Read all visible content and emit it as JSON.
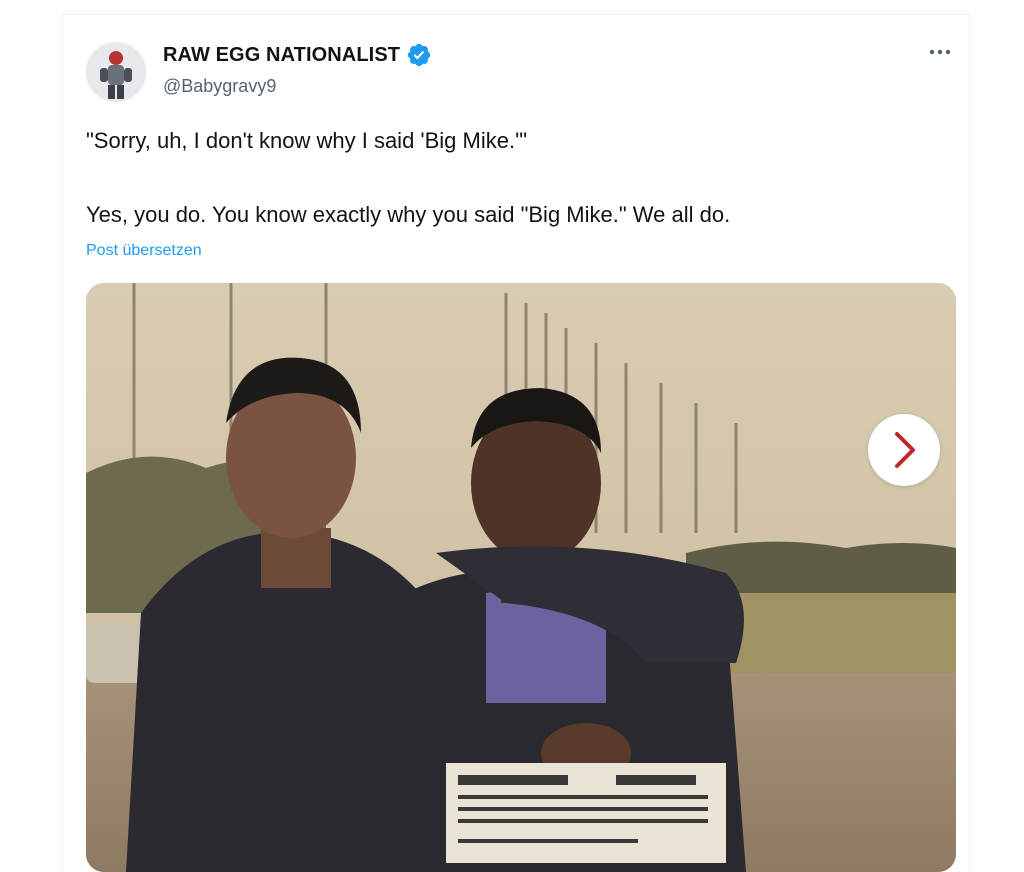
{
  "author": {
    "name": "RAW EGG NATIONALIST",
    "handle": "@Babygravy9",
    "verified_color": "#1d9bf0"
  },
  "tweet": {
    "line1": "\"Sorry, uh, I don't know why I said 'Big Mike.'\"",
    "line2": "Yes, you do. You know exactly why you said \"Big Mike.\" We all do.",
    "translate_label": "Post übersetzen"
  },
  "icons": {
    "more": "more-horizontal-icon",
    "verified": "verified-badge-icon",
    "next": "chevron-right-icon"
  },
  "colors": {
    "text": "#0f1419",
    "secondary": "#536471",
    "link": "#1d9bf0",
    "next_arrow": "#c0262b"
  }
}
